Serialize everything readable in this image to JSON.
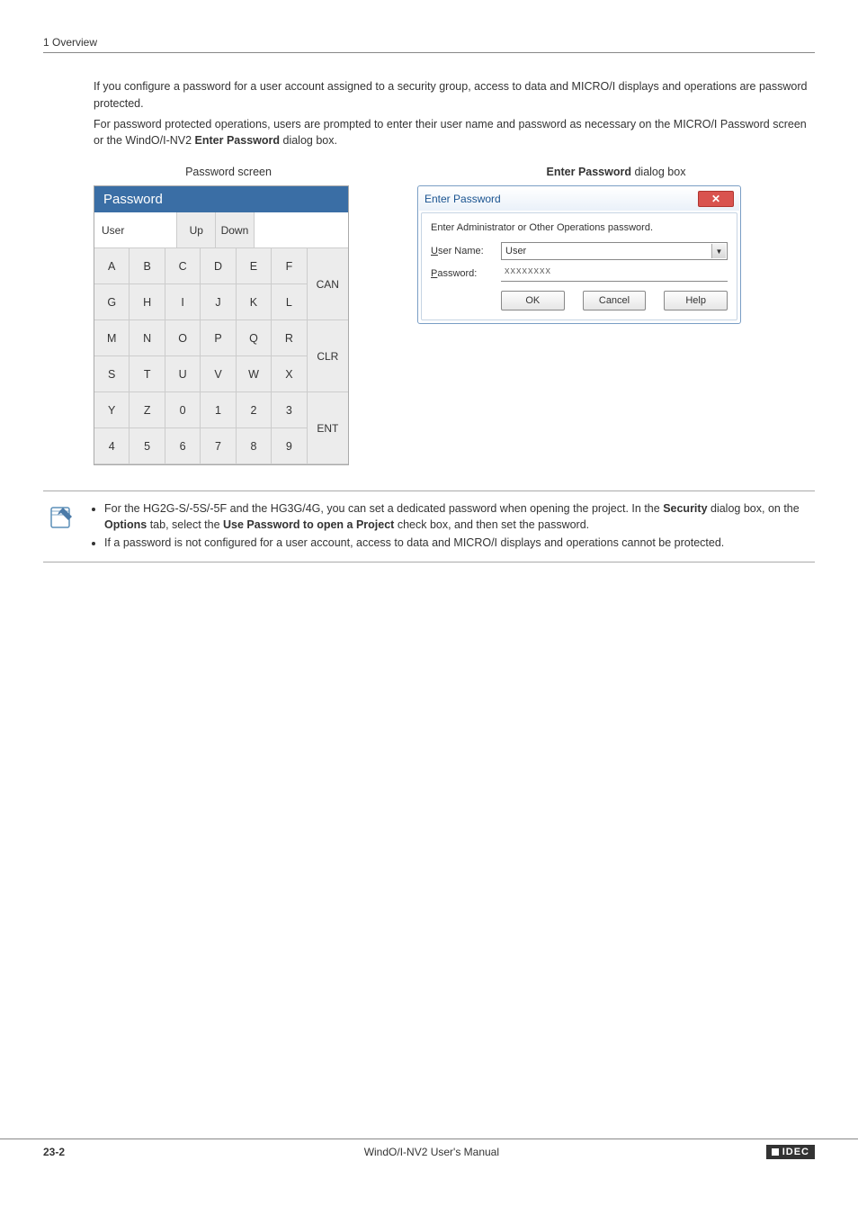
{
  "header": "1 Overview",
  "intro": {
    "p1": "If you configure a password for a user account assigned to a security group, access to data and MICRO/I displays and operations are password protected.",
    "p2_pre": "For password protected operations, users are prompted to enter their user name and password as necessary on the MICRO/I Password screen or the WindO/I-NV2 ",
    "p2_bold": "Enter Password",
    "p2_post": " dialog box."
  },
  "captions": {
    "left": "Password screen",
    "right_bold": "Enter Password",
    "right_post": " dialog box"
  },
  "pw_screen": {
    "title": "Password",
    "user": "User",
    "up": "Up",
    "down": "Down",
    "rows": [
      [
        "A",
        "B",
        "C",
        "D",
        "E",
        "F"
      ],
      [
        "G",
        "H",
        "I",
        "J",
        "K",
        "L"
      ],
      [
        "M",
        "N",
        "O",
        "P",
        "Q",
        "R"
      ],
      [
        "S",
        "T",
        "U",
        "V",
        "W",
        "X"
      ],
      [
        "Y",
        "Z",
        "0",
        "1",
        "2",
        "3"
      ],
      [
        "4",
        "5",
        "6",
        "7",
        "8",
        "9"
      ]
    ],
    "side": [
      "CAN",
      "CLR",
      "ENT"
    ]
  },
  "dialog": {
    "title": "Enter Password",
    "msg": "Enter Administrator or Other Operations password.",
    "user_label": "User Name:",
    "user_value": "User",
    "pw_label": "Password:",
    "pw_value": "xxxxxxxx",
    "ok": "OK",
    "cancel": "Cancel",
    "help": "Help"
  },
  "note": {
    "b1_pre": "For the HG2G-S/-5S/-5F  and the HG3G/4G, you can set a dedicated password when opening the project. In the ",
    "b1_b1": "Security",
    "b1_mid1": " dialog box, on the ",
    "b1_b2": "Options",
    "b1_mid2": " tab, select the ",
    "b1_b3": "Use Password to open a Project",
    "b1_post": " check box, and then set the password.",
    "b2": "If a password is not configured for a user account, access to data and MICRO/I displays and operations cannot be protected."
  },
  "footer": {
    "page": "23-2",
    "title": "WindO/I-NV2 User's Manual",
    "logo": "IDEC"
  }
}
